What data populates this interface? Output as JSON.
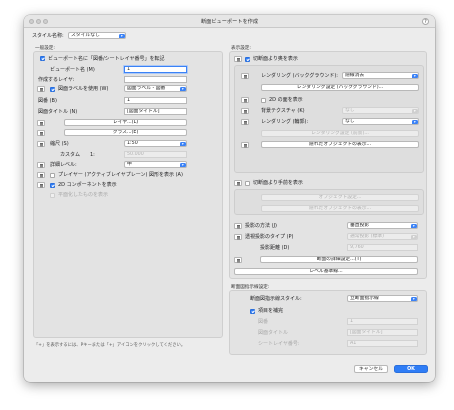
{
  "window": {
    "title": "断面ビューポートを作成",
    "help_glyph": "?"
  },
  "style": {
    "label": "スタイル名称:",
    "value": "スタイルなし"
  },
  "general": {
    "section": "一般設定:",
    "add_name_label": "ビューポート名に「図番/シートレイヤ番号」を転記",
    "viewport_name_label": "ビューポート名 (M)",
    "viewport_name_value": "1",
    "create_layer_label": "作成するレイヤ:",
    "drawing_label_label": "図面ラベルを使用 (W)",
    "drawing_label_value": "図面ラベル - 図番",
    "drawing_no_label": "図番 (B)",
    "drawing_no_value": "1",
    "drawing_title_label": "図面タイトル (N)",
    "drawing_title_value": "[図面タイトル]",
    "layer_button": "レイヤ...(L)",
    "class_button": "クラス...(E)",
    "scale_label": "縮尺 (S)",
    "scale_value": "1:50",
    "custom_label": "カスタム",
    "custom_left": "1:",
    "custom_value": "50.000",
    "detail_label": "詳細レベル:",
    "detail_value": "中",
    "planar_label": "プレイヤー (アクティブレイヤプレーン) 図形を表示 (A)",
    "component_label": "2D コンポーネントを表示",
    "mirror_label": "平面化したものを表示"
  },
  "display": {
    "section": "表示設定:",
    "cut_plane_label": "切断面より奥を表示",
    "render_bg_label": "レンダリング (バックグラウンド):",
    "render_bg_value": "隠線消去",
    "render_bg_settings": "レンダリング設定 (バックグラウンド)...",
    "show_2d_label": "2D の面を表示",
    "bg_texture_label": "背景テクスチャ (K)",
    "bg_texture_value": "なし",
    "render_fg_label": "レンダリング (輪郭):",
    "render_fg_value": "なし",
    "render_fg_settings": "レンダリング設定 (前景)...",
    "hidden_objects_1": "隠れたオブジェクトの表示...",
    "front_label": "切断面より手前を表示",
    "object_settings": "オブジェクト設定...",
    "hidden_objects_2": "隠れたオブジェクトの表示...",
    "projection_label": "投影の方法 (J)",
    "projection_value": "垂直投影",
    "perspective_label": "透視投影のタイプ (P)",
    "perspective_value": "通常投影 (標準)",
    "distance_label": "投影距離 (D)",
    "distance_value": "9,760",
    "section_detail_button": "断面の詳細設定...(T)",
    "level_button": "レベル基準線..."
  },
  "callout": {
    "section": "断面図指示線設定:",
    "style_label": "断面図指示線スタイル:",
    "style_value": "立断面指示線",
    "complete_label": "項目を補完",
    "no_label": "図番",
    "no_value": "1",
    "title_label": "図面タイトル",
    "title_value": "[図面タイトル]",
    "sheet_label": "シートレイヤ番号:",
    "sheet_value": "A1"
  },
  "footer": {
    "note": "「+」を表示するには、Pキーまたは「+」アイコンをクリックしてください。",
    "cancel": "キャンセル",
    "ok": "OK"
  },
  "colors": {
    "accent": "#2f7df6",
    "window_bg": "#ececec"
  }
}
